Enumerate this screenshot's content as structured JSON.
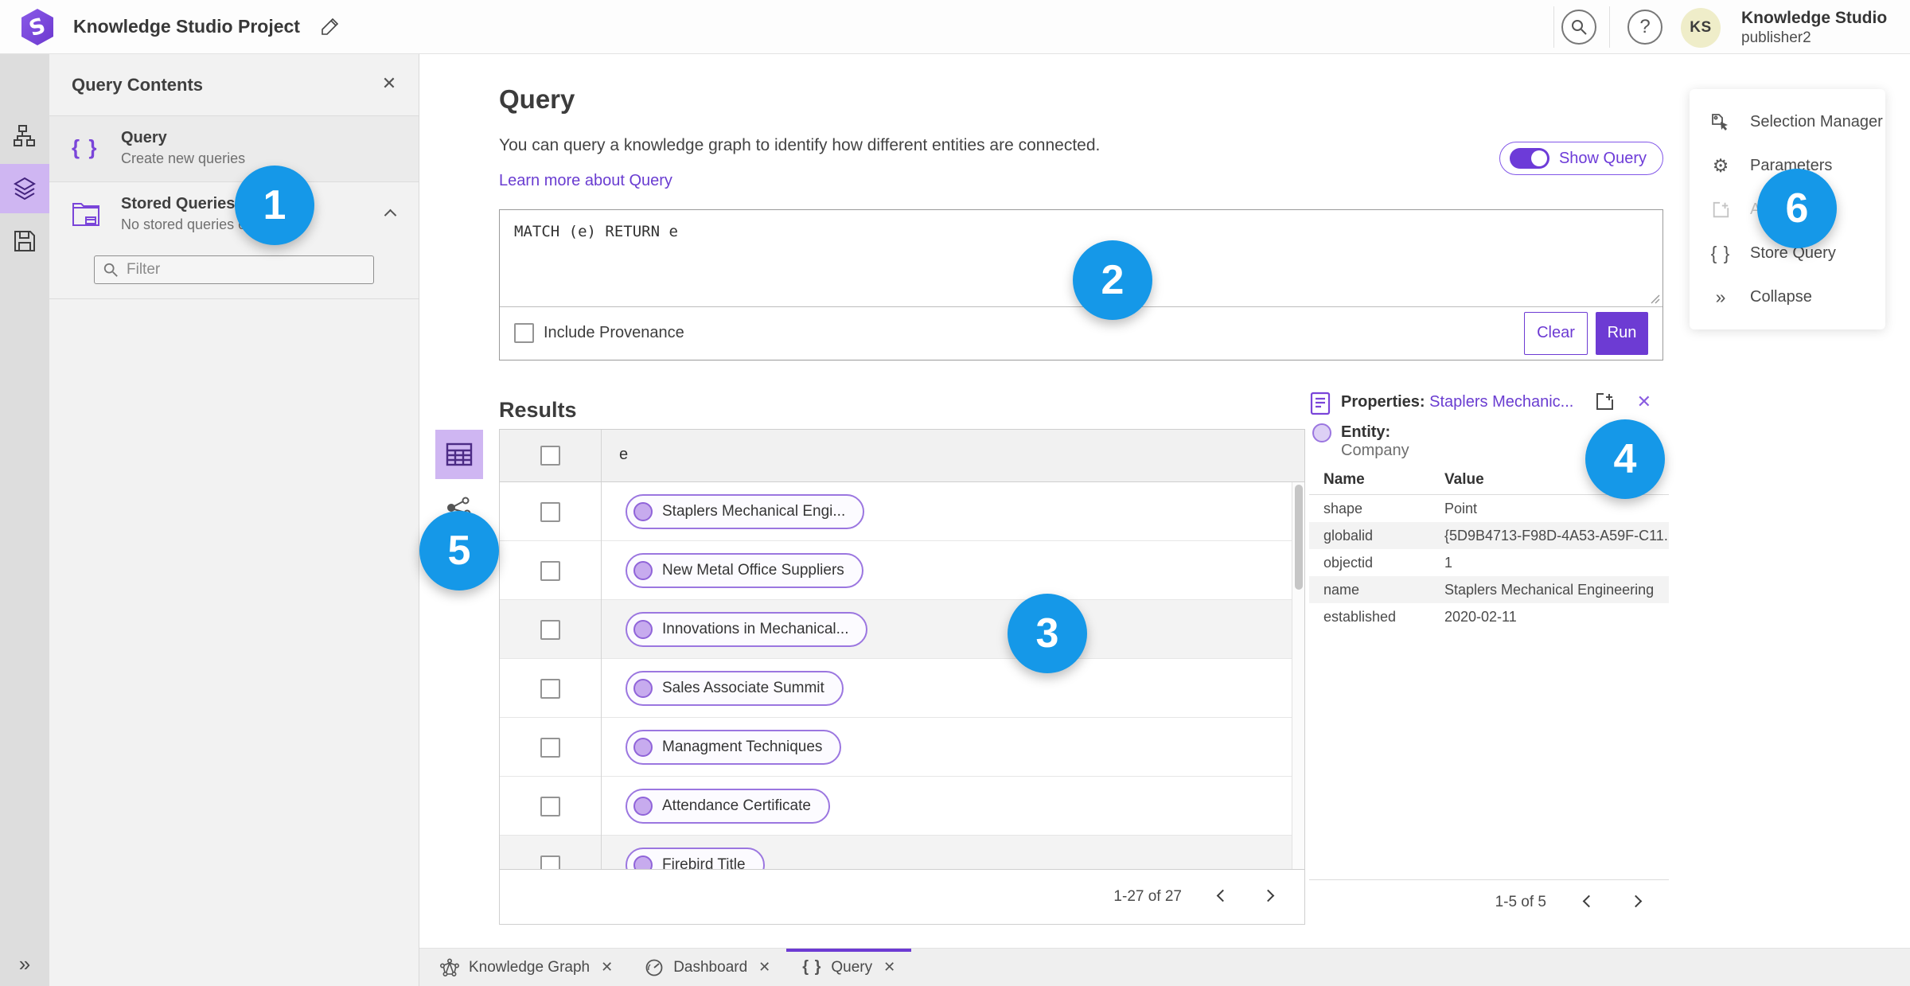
{
  "header": {
    "app_title": "Knowledge Studio Project",
    "user_name": "Knowledge Studio",
    "user_sub": "publisher2",
    "avatar_initials": "KS",
    "help_glyph": "?"
  },
  "contents_panel": {
    "title": "Query Contents",
    "close_glyph": "✕",
    "query_item": {
      "label": "Query",
      "sublabel": "Create new queries",
      "icon_glyph": "{ }"
    },
    "stored_item": {
      "label": "Stored Queries",
      "sublabel": "No stored queries exist"
    },
    "filter_placeholder": "Filter"
  },
  "query_section": {
    "title": "Query",
    "description": "You can query a knowledge graph to identify how different entities are connected.",
    "link_label": "Learn more about Query",
    "toggle_label": "Show Query",
    "query_text": "MATCH (e) RETURN e",
    "provenance_label": "Include Provenance",
    "clear_label": "Clear",
    "run_label": "Run"
  },
  "results": {
    "title": "Results",
    "column_header": "e",
    "rows": [
      "Staplers Mechanical Engi...",
      "New Metal Office Suppliers",
      "Innovations in Mechanical...",
      "Sales Associate Summit",
      "Managment Techniques",
      "Attendance Certificate",
      "Firebird Title"
    ],
    "pagination": "1-27 of 27"
  },
  "properties": {
    "title": "Properties:",
    "selected_link": "Staplers Mechanic...",
    "close_glyph": "✕",
    "entity_label": "Entity:",
    "entity_type": "Company",
    "col_name": "Name",
    "col_value": "Value",
    "rows": [
      [
        "shape",
        "Point"
      ],
      [
        "globalid",
        "{5D9B4713-F98D-4A53-A59F-C11..."
      ],
      [
        "objectid",
        "1"
      ],
      [
        "name",
        "Staplers Mechanical Engineering"
      ],
      [
        "established",
        "2020-02-11"
      ]
    ],
    "pagination": "1-5 of 5"
  },
  "side_menu": {
    "items": [
      {
        "label": "Selection Manager"
      },
      {
        "label": "Parameters",
        "icon_glyph": "⚙"
      },
      {
        "label": "Add",
        "disabled": true
      },
      {
        "label": "Store Query",
        "icon_glyph": "{ }"
      },
      {
        "label": "Collapse",
        "icon_glyph": "»"
      }
    ]
  },
  "tabs": {
    "close_glyph": "✕",
    "items": [
      {
        "label": "Knowledge Graph"
      },
      {
        "label": "Dashboard"
      },
      {
        "label": "Query",
        "icon_glyph": "{ }",
        "active": true
      }
    ]
  },
  "rail": {
    "collapse_glyph": "»"
  },
  "callouts": {
    "n1": "1",
    "n2": "2",
    "n3": "3",
    "n4": "4",
    "n5": "5",
    "n6": "6"
  },
  "colors": {
    "accent_purple": "#6d3bd3",
    "light_purple": "#cfb6f2",
    "callout_blue": "#1598e8",
    "avatar_bg": "#efedc9",
    "pill_border": "#9b76e0"
  }
}
